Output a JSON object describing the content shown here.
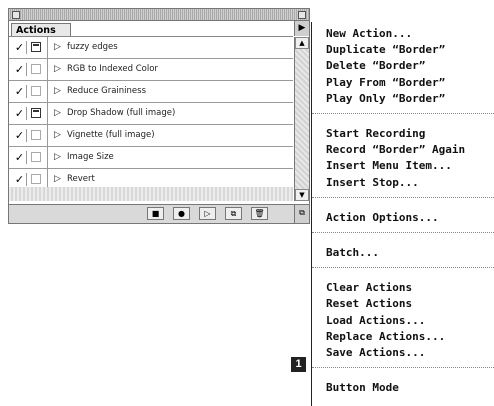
{
  "palette": {
    "tab_label": "Actions",
    "menu_arrow_glyph": "▶",
    "rows": [
      {
        "check": "✓",
        "label": "fuzzy edges",
        "dialog_on": true
      },
      {
        "check": "✓",
        "label": "RGB to Indexed Color",
        "dialog_on": false
      },
      {
        "check": "✓",
        "label": "Reduce Graininess",
        "dialog_on": false
      },
      {
        "check": "✓",
        "label": "Drop Shadow (full image)",
        "dialog_on": true
      },
      {
        "check": "✓",
        "label": "Vignette (full image)",
        "dialog_on": false
      },
      {
        "check": "✓",
        "label": "Image Size",
        "dialog_on": false
      },
      {
        "check": "✓",
        "label": "Revert",
        "dialog_on": false
      }
    ],
    "expand_glyph": "▷",
    "bottom_buttons": [
      {
        "name": "stop-icon",
        "glyph": "■"
      },
      {
        "name": "record-icon",
        "glyph": "●"
      },
      {
        "name": "play-icon",
        "glyph": "▷"
      },
      {
        "name": "new-set-icon",
        "glyph": "⧉"
      },
      {
        "name": "trash-icon",
        "glyph": "🗑"
      }
    ]
  },
  "menu": {
    "groups": [
      [
        "New Action...",
        "Duplicate “Border”",
        "Delete “Border”",
        "Play From “Border”",
        "Play Only “Border”"
      ],
      [
        "Start Recording",
        "Record “Border” Again",
        "Insert Menu Item...",
        "Insert Stop..."
      ],
      [
        "Action Options..."
      ],
      [
        "Batch..."
      ],
      [
        "Clear Actions",
        "Reset Actions",
        "Load Actions...",
        "Replace Actions...",
        "Save Actions..."
      ],
      [
        "Button Mode"
      ]
    ]
  },
  "callout": {
    "number": "1"
  }
}
